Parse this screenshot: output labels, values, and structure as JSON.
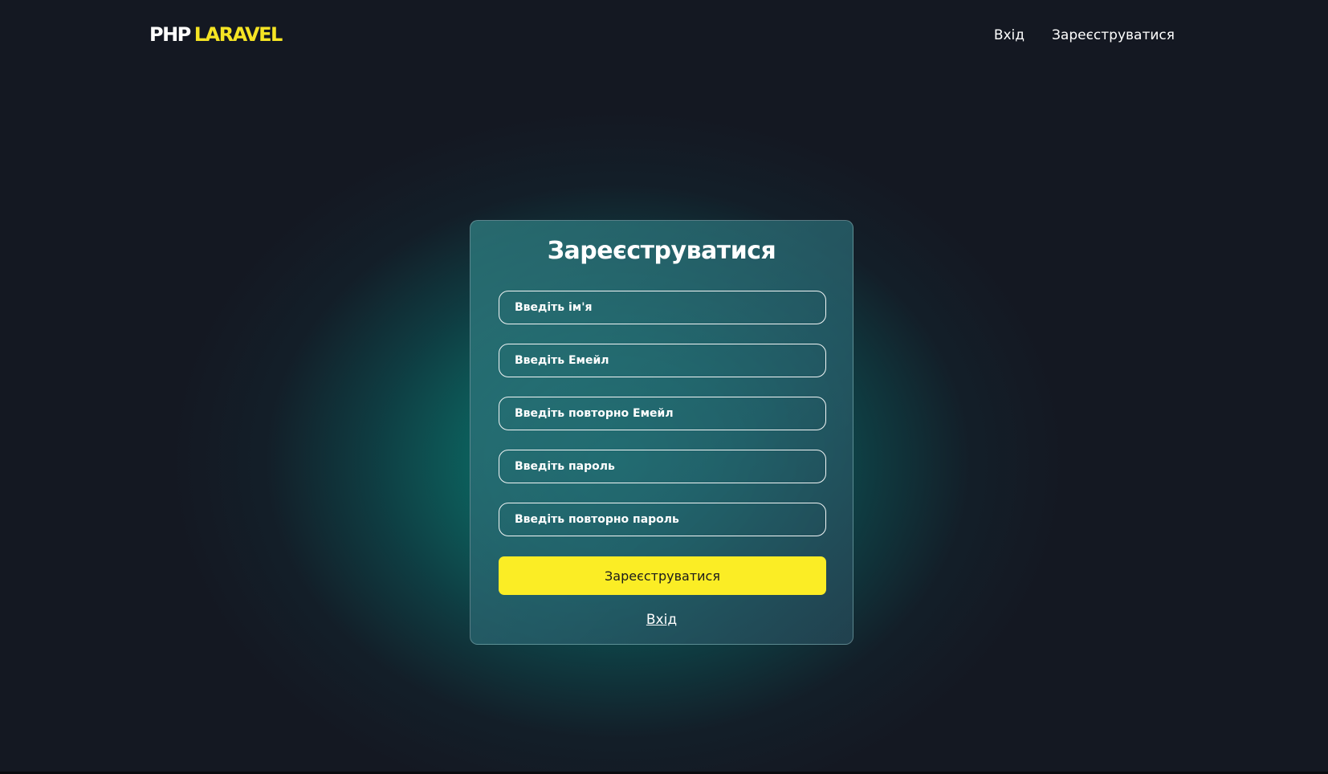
{
  "header": {
    "logo_php": "PHP",
    "logo_laravel": "LARAVEL",
    "nav": {
      "login": "Вхід",
      "register": "Зареєструватися"
    }
  },
  "form": {
    "title": "Зареєструватися",
    "fields": {
      "name_placeholder": "Введіть ім'я",
      "email_placeholder": "Введіть Емейл",
      "email_confirm_placeholder": "Введіть повторно Емейл",
      "password_placeholder": "Введіть пароль",
      "password_confirm_placeholder": "Введіть повторно пароль"
    },
    "submit_label": "Зареєструватися",
    "login_link": "Вхід"
  },
  "colors": {
    "background": "#141822",
    "accent_yellow": "#fbed25",
    "glow_teal": "#098076"
  }
}
